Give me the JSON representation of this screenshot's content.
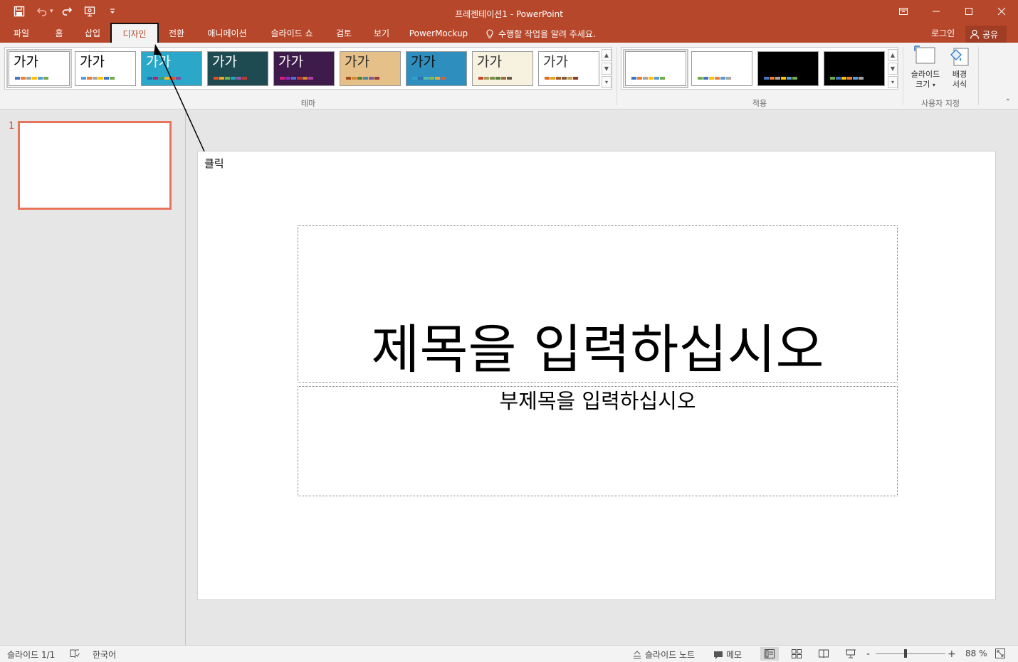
{
  "window": {
    "title": "프레젠테이션1 - PowerPoint"
  },
  "tabs": [
    {
      "label": "파일"
    },
    {
      "label": "홈"
    },
    {
      "label": "삽입"
    },
    {
      "label": "디자인"
    },
    {
      "label": "전환"
    },
    {
      "label": "애니메이션"
    },
    {
      "label": "슬라이드 쇼"
    },
    {
      "label": "검토"
    },
    {
      "label": "보기"
    },
    {
      "label": "PowerMockup"
    }
  ],
  "active_tab": "디자인",
  "tell_me": "수행할 작업을 알려 주세요.",
  "account": {
    "login": "로그인",
    "share": "공유"
  },
  "ribbon": {
    "themes": {
      "group_label": "테마",
      "items": [
        {
          "text": "가가",
          "bg": "#ffffff",
          "fg": "#000000",
          "bars": [
            "#4472c4",
            "#ed7d31",
            "#a5a5a5",
            "#ffc000",
            "#5b9bd5",
            "#70ad47"
          ]
        },
        {
          "text": "가가",
          "bg": "#ffffff",
          "fg": "#000000",
          "bars": [
            "#5b9bd5",
            "#ed7d31",
            "#a5a5a5",
            "#ffc000",
            "#4472c4",
            "#70ad47"
          ]
        },
        {
          "text": "가가",
          "bg": "#2aa7c9",
          "fg": "#ffffff",
          "bars": [
            "#1f6fb2",
            "#b5216b",
            "#31a36b",
            "#f3b81e",
            "#e5502c",
            "#7c4fa6"
          ]
        },
        {
          "text": "가가",
          "bg": "#1e4b52",
          "fg": "#ffffff",
          "bars": [
            "#e34e27",
            "#e8a82a",
            "#74b24a",
            "#1fa7b9",
            "#8e5ba6",
            "#c1382f"
          ]
        },
        {
          "text": "가가",
          "bg": "#3d1b4a",
          "fg": "#ffffff",
          "bars": [
            "#d61f80",
            "#8e2bbf",
            "#4a6fd6",
            "#c43535",
            "#d8862a",
            "#b23fa1"
          ]
        },
        {
          "text": "가가",
          "bg": "#e6c089",
          "fg": "#2a2a2a",
          "bars": [
            "#a24d1c",
            "#d08a2e",
            "#5c7b3c",
            "#4d89a3",
            "#7c5c8c",
            "#9b3b3b"
          ]
        },
        {
          "text": "가가",
          "bg": "#2e8fbf",
          "fg": "#111111",
          "bars": [
            "#2ea2c9",
            "#2f6ea8",
            "#4fbfae",
            "#8ab94a",
            "#e0a93b",
            "#d2653c"
          ]
        },
        {
          "text": "가가",
          "bg": "#f6f2df",
          "fg": "#333333",
          "bars": [
            "#c5452b",
            "#a59a57",
            "#7c8c4a",
            "#5e7d3a",
            "#9b6b3e",
            "#6b5b44"
          ]
        },
        {
          "text": "가가",
          "bg": "#ffffff",
          "fg": "#333333",
          "bars": [
            "#e06b1f",
            "#e8a01f",
            "#a55b2b",
            "#7b5e3b",
            "#c79a4a",
            "#8c3f1f"
          ]
        }
      ]
    },
    "variants": {
      "group_label": "적용",
      "items": [
        {
          "bg": "#ffffff",
          "bars": [
            "#4472c4",
            "#ed7d31",
            "#a5a5a5",
            "#ffc000",
            "#5b9bd5",
            "#70ad47"
          ]
        },
        {
          "bg": "#ffffff",
          "bars": [
            "#70ad47",
            "#4472c4",
            "#ffc000",
            "#ed7d31",
            "#5b9bd5",
            "#a5a5a5"
          ]
        },
        {
          "bg": "#000000",
          "bars": [
            "#4472c4",
            "#ed7d31",
            "#a5a5a5",
            "#ffc000",
            "#5b9bd5",
            "#70ad47"
          ]
        },
        {
          "bg": "#000000",
          "bars": [
            "#70ad47",
            "#4472c4",
            "#ffc000",
            "#ed7d31",
            "#5b9bd5",
            "#a5a5a5"
          ]
        }
      ]
    },
    "customize": {
      "group_label": "사용자 지정",
      "slide_size_line1": "슬라이드",
      "slide_size_line2": "크기",
      "format_bg_line1": "배경",
      "format_bg_line2": "서식"
    }
  },
  "slides_pane": {
    "slide_number": "1"
  },
  "slide": {
    "title_placeholder": "제목을 입력하십시오",
    "subtitle_placeholder": "부제목을 입력하십시오"
  },
  "annotation": {
    "label": "클릭"
  },
  "statusbar": {
    "slide_counter": "슬라이드 1/1",
    "language": "한국어",
    "notes": "슬라이드 노트",
    "comments": "메모",
    "zoom": "88 %"
  }
}
